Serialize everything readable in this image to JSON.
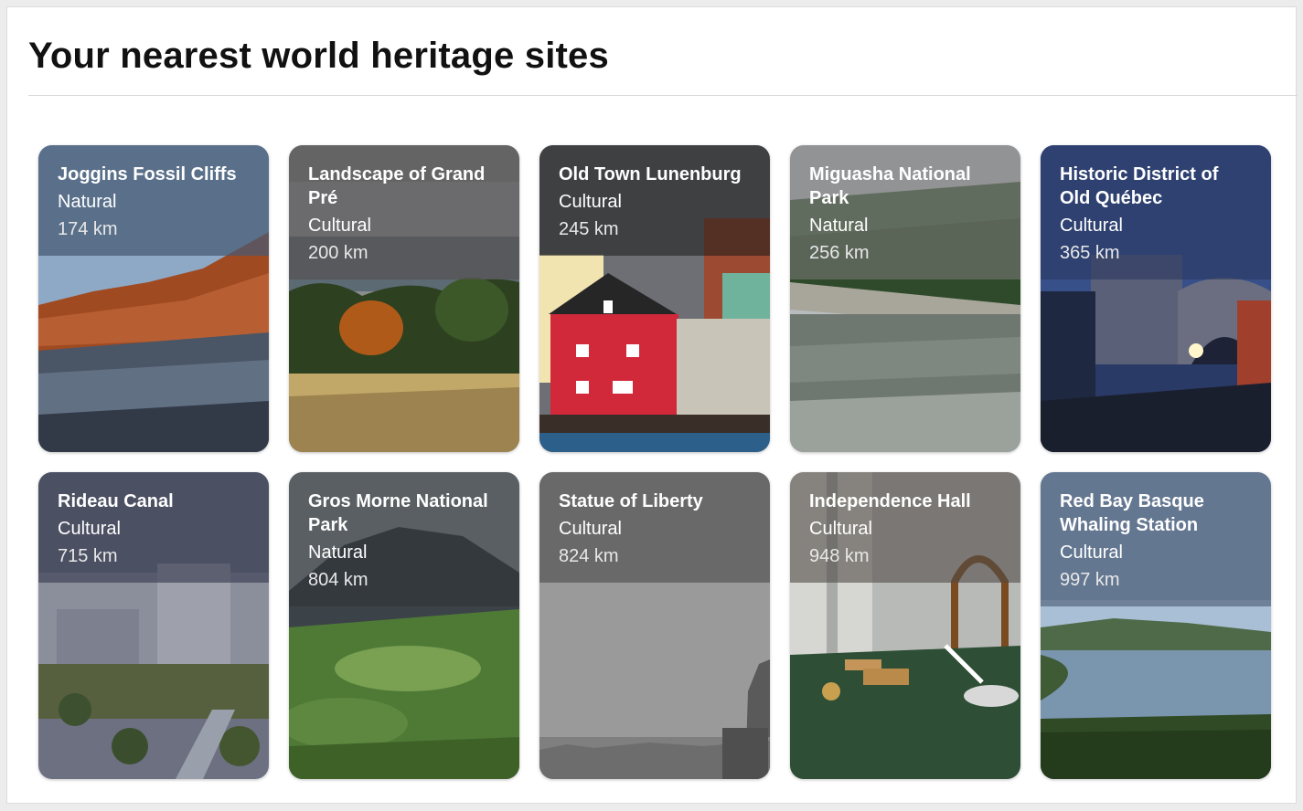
{
  "page": {
    "title": "Your nearest world heritage sites"
  },
  "sites": [
    {
      "name": "Joggins Fossil Cliffs",
      "type": "Natural",
      "distance": "174 km",
      "overlay": "rgba(70,90,115,0.72)"
    },
    {
      "name": "Landscape of Grand Pré",
      "type": "Cultural",
      "distance": "200 km",
      "overlay": "rgba(85,82,82,0.70)"
    },
    {
      "name": "Old Town Lunenburg",
      "type": "Cultural",
      "distance": "245 km",
      "overlay": "rgba(25,25,25,0.62)"
    },
    {
      "name": "Miguasha National Park",
      "type": "Natural",
      "distance": "256 km",
      "overlay": "rgba(120,120,120,0.62)"
    },
    {
      "name": "Historic District of Old Québec",
      "type": "Cultural",
      "distance": "365 km",
      "overlay": "rgba(40,55,95,0.72)"
    },
    {
      "name": "Rideau Canal",
      "type": "Cultural",
      "distance": "715 km",
      "overlay": "rgba(60,65,85,0.70)"
    },
    {
      "name": "Gros Morne National Park",
      "type": "Natural",
      "distance": "804 km",
      "overlay": "rgba(45,50,55,0.65)"
    },
    {
      "name": "Statue of Liberty",
      "type": "Cultural",
      "distance": "824 km",
      "overlay": "rgba(90,90,90,0.72)"
    },
    {
      "name": "Independence Hall",
      "type": "Cultural",
      "distance": "948 km",
      "overlay": "rgba(80,75,70,0.68)"
    },
    {
      "name": "Red Bay Basque Whaling Station",
      "type": "Cultural",
      "distance": "997 km",
      "overlay": "rgba(75,90,115,0.70)"
    }
  ]
}
